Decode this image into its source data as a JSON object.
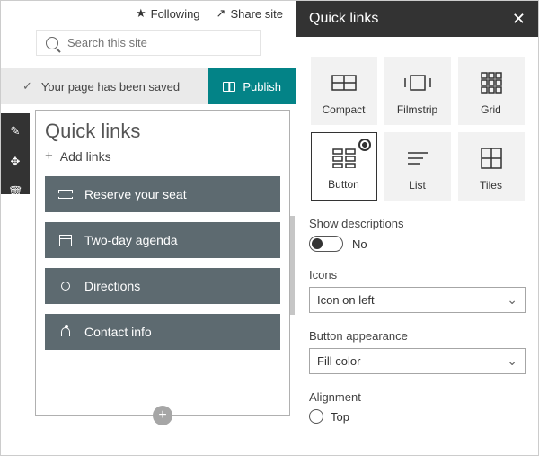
{
  "header": {
    "following": "Following",
    "share": "Share site",
    "search_placeholder": "Search this site"
  },
  "status": {
    "message": "Your page has been saved",
    "publish": "Publish"
  },
  "widget": {
    "title": "Quick links",
    "add": "Add links",
    "items": [
      {
        "label": "Reserve your seat"
      },
      {
        "label": "Two-day agenda"
      },
      {
        "label": "Directions"
      },
      {
        "label": "Contact info"
      }
    ]
  },
  "panel": {
    "title": "Quick links",
    "layouts": [
      {
        "label": "Compact"
      },
      {
        "label": "Filmstrip"
      },
      {
        "label": "Grid"
      },
      {
        "label": "Button"
      },
      {
        "label": "List"
      },
      {
        "label": "Tiles"
      }
    ],
    "selected_layout": "Button",
    "show_desc_label": "Show descriptions",
    "show_desc_value": "No",
    "icons_label": "Icons",
    "icons_value": "Icon on left",
    "appearance_label": "Button appearance",
    "appearance_value": "Fill color",
    "alignment_label": "Alignment",
    "alignment_value": "Top"
  }
}
